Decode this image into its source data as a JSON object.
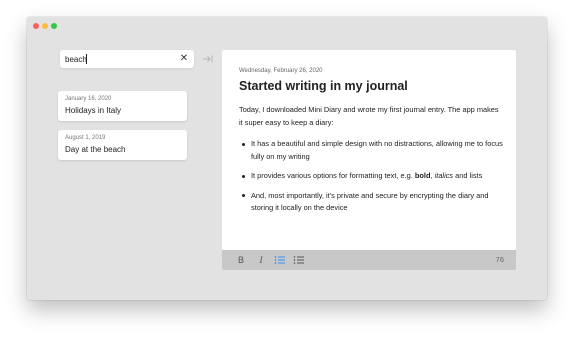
{
  "search": {
    "value": "beach",
    "clear_icon": "✕"
  },
  "entries": [
    {
      "date": "January 16, 2020",
      "title": "Holidays in Italy"
    },
    {
      "date": "August 1, 2019",
      "title": "Day at the beach"
    }
  ],
  "editor": {
    "date": "Wednesday, February 26, 2020",
    "title": "Started writing in my journal",
    "intro": "Today, I downloaded Mini Diary and wrote my first journal entry. The app makes it super easy to keep a diary:",
    "bullet1": "It has a beautiful and simple design with no distractions, allowing me to focus fully on my writing",
    "bullet2_pre": "It provides various options for formatting text, e.g. ",
    "bullet2_bold": "bold",
    "bullet2_mid": ", ",
    "bullet2_italic": "italics",
    "bullet2_post": " and lists",
    "bullet3": "And, most importantly, it's private and secure by encrypting the diary and storing it locally on the device"
  },
  "toolbar": {
    "bold_label": "B",
    "italic_label": "I",
    "word_count": "76"
  },
  "colors": {
    "window_bg": "#e2e2e2",
    "toolbar_bg": "#c8c8c8",
    "active_icon": "#3d8bf2"
  }
}
